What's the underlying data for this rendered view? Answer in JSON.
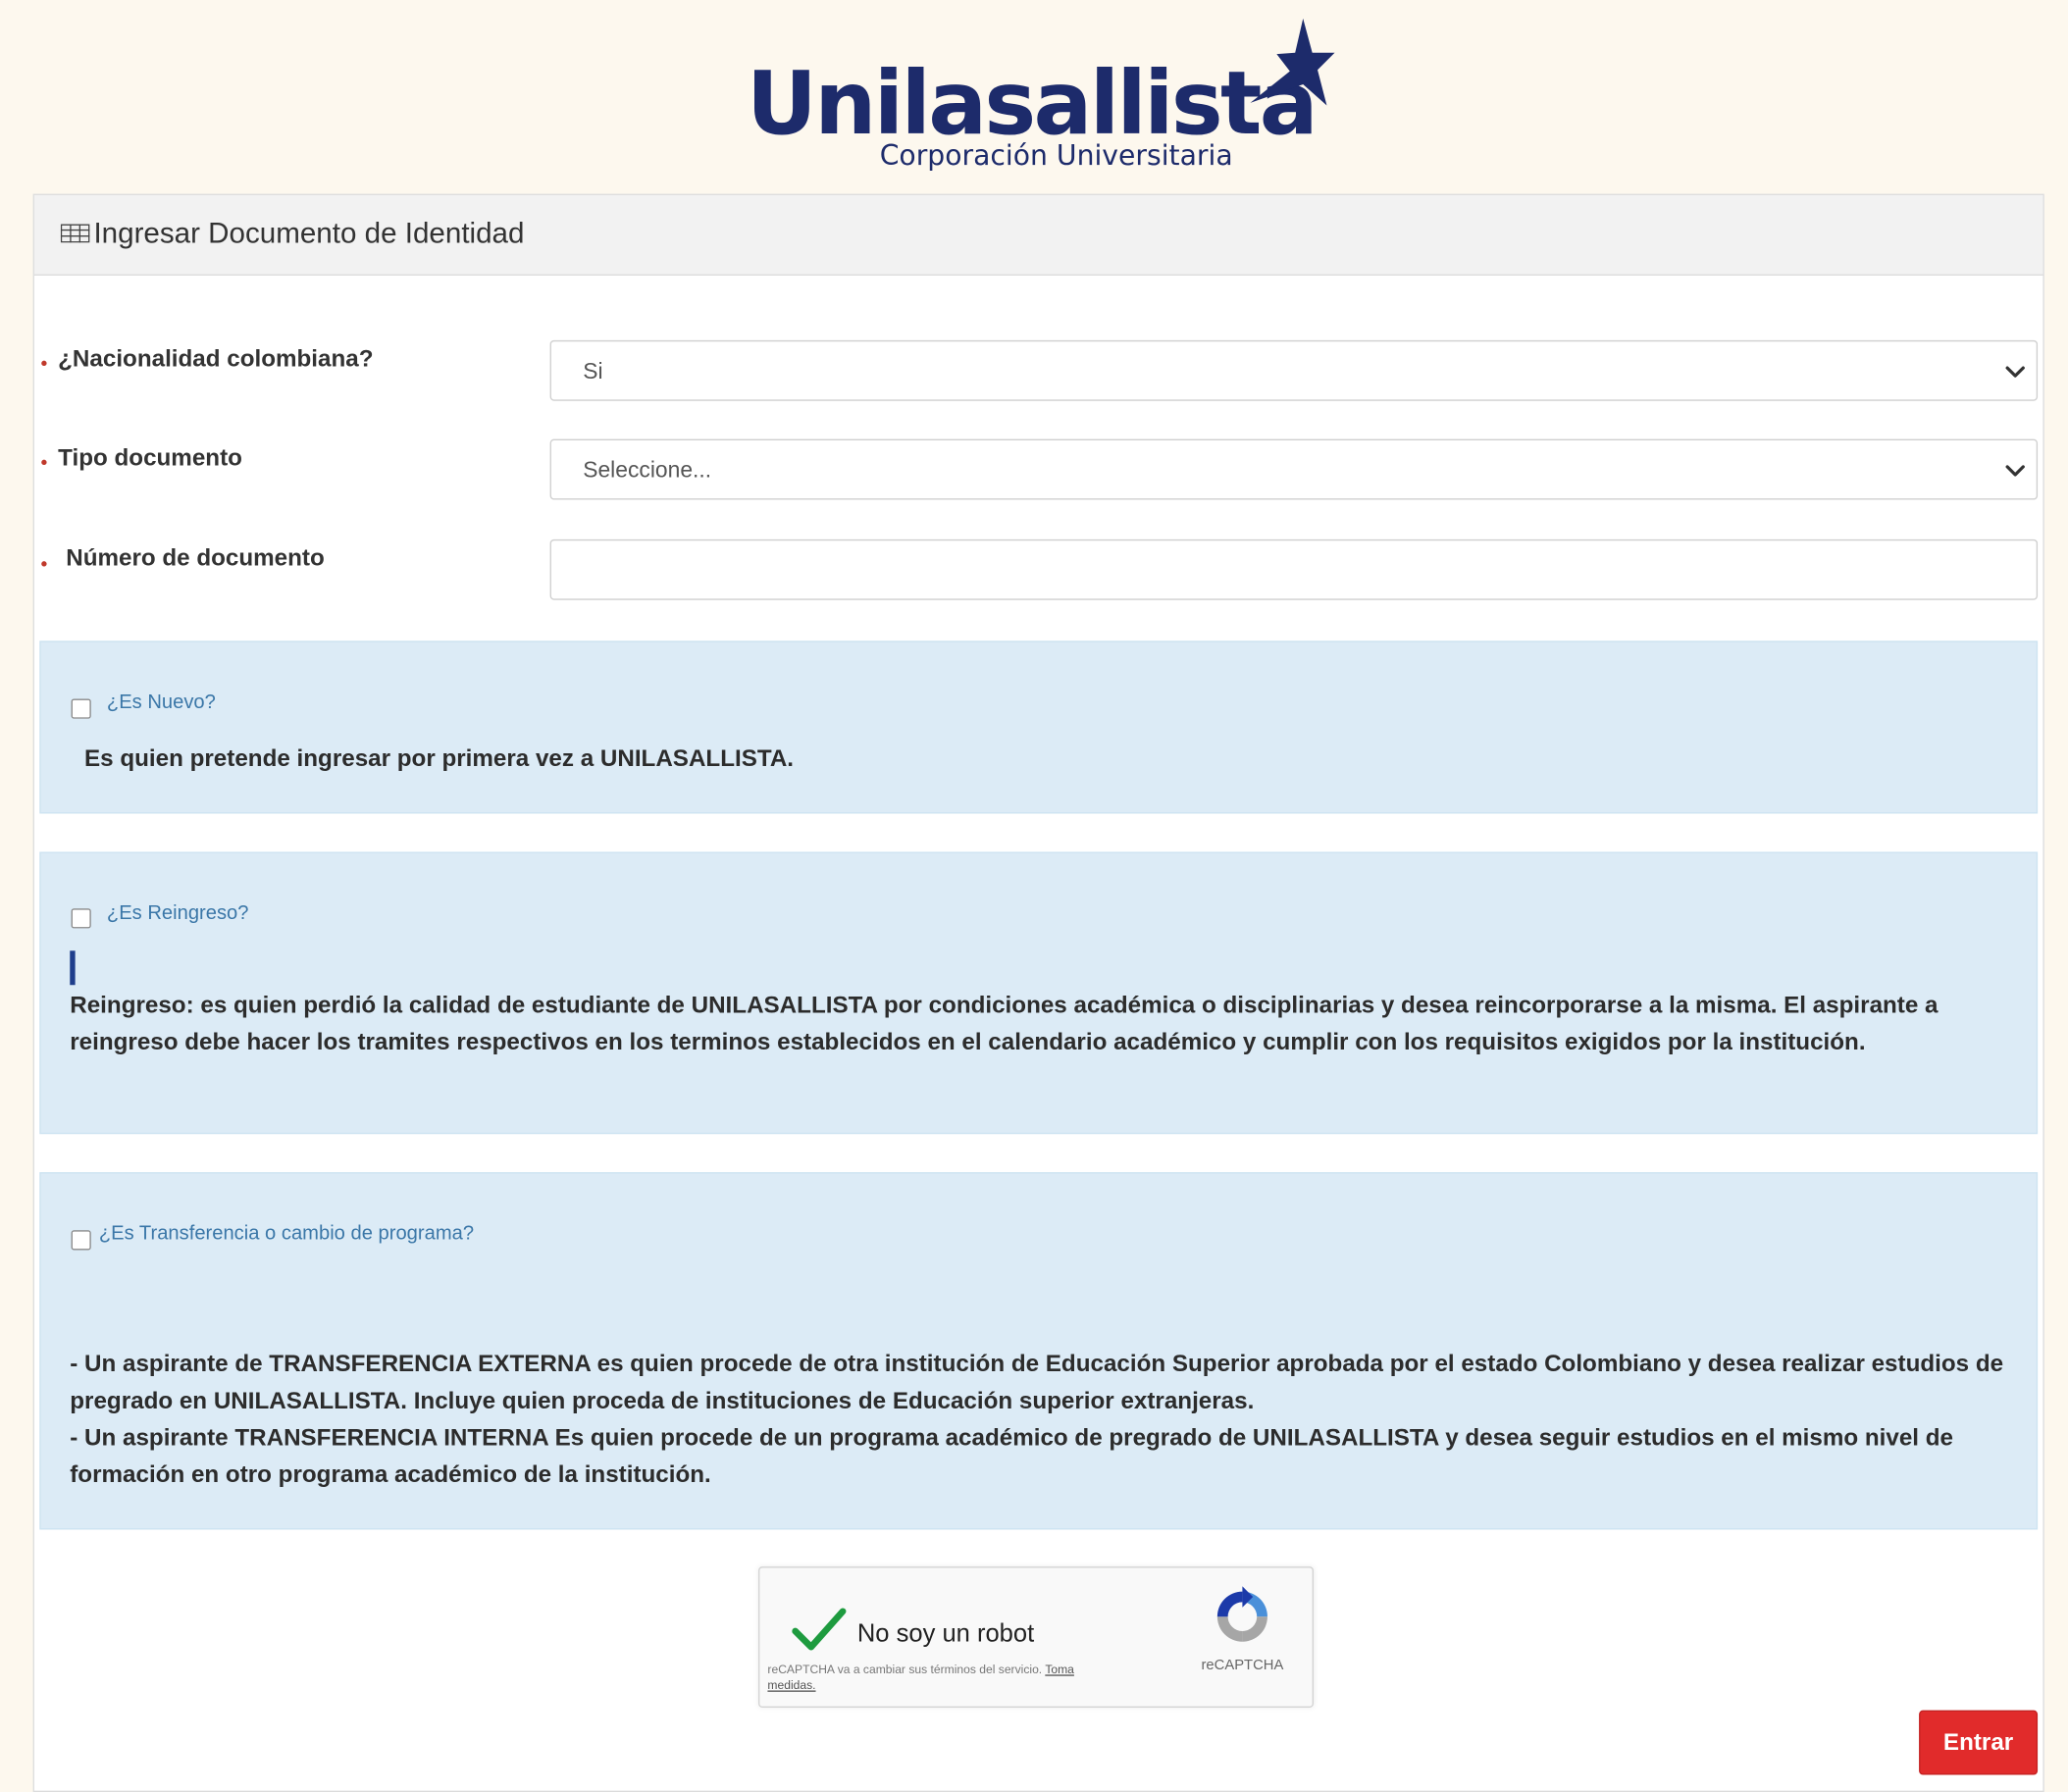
{
  "header": {
    "logo_word": "Unilasallista",
    "logo_subtitle": "Corporación Universitaria"
  },
  "panel": {
    "title": "Ingresar Documento de Identidad"
  },
  "form": {
    "nationality": {
      "label": "¿Nacionalidad colombiana?",
      "value": "Si"
    },
    "doc_type": {
      "label": "Tipo documento",
      "value": "Seleccione..."
    },
    "doc_number": {
      "label": "Número de documento",
      "value": ""
    },
    "required_marker": "•"
  },
  "options": [
    {
      "label": "¿Es Nuevo?",
      "checked": false,
      "description": "Es quien pretende ingresar por primera vez a UNILASALLISTA."
    },
    {
      "label": "¿Es Reingreso?",
      "checked": false,
      "description": "Reingreso: es quien perdió la calidad de estudiante de UNILASALLISTA por condiciones académica o disciplinarias y desea reincorporarse a la misma. El aspirante a reingreso debe hacer los tramites respectivos en los terminos establecidos en el calendario académico y cumplir con los requisitos exigidos por la institución."
    },
    {
      "label": "¿Es Transferencia o cambio de programa?",
      "checked": false,
      "description_lines": [
        "- Un aspirante de TRANSFERENCIA EXTERNA es quien procede de otra institución de Educación Superior aprobada por el estado Colombiano y desea realizar estudios de pregrado en UNILASALLISTA. Incluye quien proceda de instituciones de Educación superior extranjeras.",
        "- Un aspirante TRANSFERENCIA INTERNA Es quien procede de un programa académico de pregrado de UNILASALLISTA y desea seguir estudios en el mismo nivel de formación en otro programa académico de la institución."
      ]
    }
  ],
  "captcha": {
    "label": "No soy un robot",
    "terms": "reCAPTCHA va a cambiar sus términos del servicio.",
    "terms_link": "Toma medidas.",
    "brand": "reCAPTCHA",
    "checked": true
  },
  "actions": {
    "submit_label": "Entrar"
  },
  "colors": {
    "brand_navy": "#1d2b6b",
    "info_background": "#dcebf6",
    "submit_red": "#e12b2b",
    "required_red": "#c0392b",
    "captcha_check_green": "#1e9b3f"
  },
  "icons": [
    "star-icon",
    "table-icon",
    "chevron-down-icon",
    "checkmark-icon",
    "recaptcha-logo-icon"
  ]
}
